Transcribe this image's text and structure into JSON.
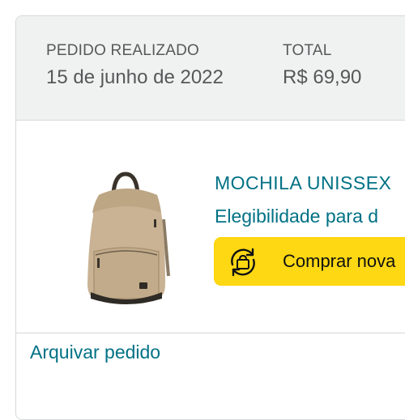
{
  "order": {
    "placed_label": "PEDIDO REALIZADO",
    "placed_date": "15 de junho de 2022",
    "total_label": "TOTAL",
    "total_value": "R$ 69,90"
  },
  "item": {
    "title": "MOCHILA UNISSEX",
    "eligibility": "Elegibilidade para d",
    "buy_again_label": "Comprar nova",
    "image_icon": "backpack-image"
  },
  "actions": {
    "archive_label": "Arquivar pedido"
  },
  "colors": {
    "link": "#007185",
    "button": "#ffd814",
    "header_bg": "#f0f2f2",
    "border": "#d5d9d9"
  }
}
